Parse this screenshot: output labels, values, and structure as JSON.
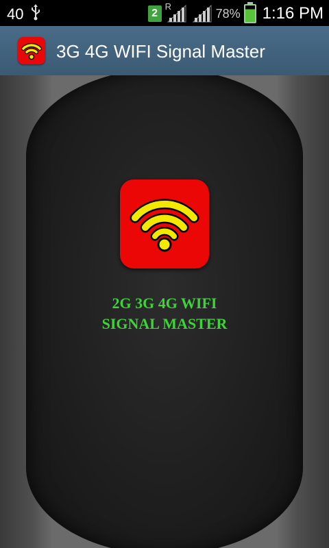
{
  "status_bar": {
    "notification_count": "40",
    "sim_slot": "2",
    "roaming_indicator": "R",
    "battery_percent": "78%",
    "time": "1:16 PM",
    "icons": [
      "usb-icon",
      "sim-icon",
      "signal-icon",
      "battery-icon"
    ]
  },
  "action_bar": {
    "title": "3G 4G WIFI Signal Master",
    "icon": "wifi-icon"
  },
  "main": {
    "logo_icon": "wifi-icon",
    "headline_line1": "2G 3G 4G WIFI",
    "headline_line2": "SIGNAL MASTER"
  },
  "colors": {
    "accent_red": "#ec0707",
    "wifi_yellow": "#f2e800",
    "headline_green": "#3fd23a",
    "action_bar": "#45657f"
  }
}
